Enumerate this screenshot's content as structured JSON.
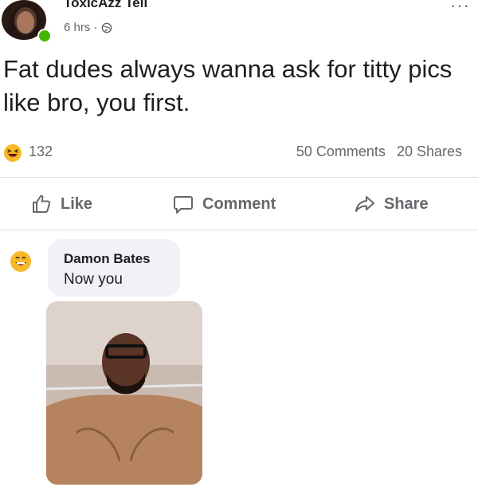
{
  "post": {
    "author": "ToxicAzz Tell",
    "time": "6 hrs ·",
    "text": "Fat dudes always wanna ask for titty pics like bro, you first.",
    "more_label": "···"
  },
  "stats": {
    "reaction_count": "132",
    "comments": "50 Comments",
    "shares": "20 Shares"
  },
  "actions": {
    "like": "Like",
    "comment": "Comment",
    "share": "Share"
  },
  "comment": {
    "author": "Damon Bates",
    "text": "Now you"
  },
  "colors": {
    "text": "#1c1e21",
    "meta": "#65676b",
    "bubble": "#f0f2f5",
    "online": "#44b700"
  }
}
